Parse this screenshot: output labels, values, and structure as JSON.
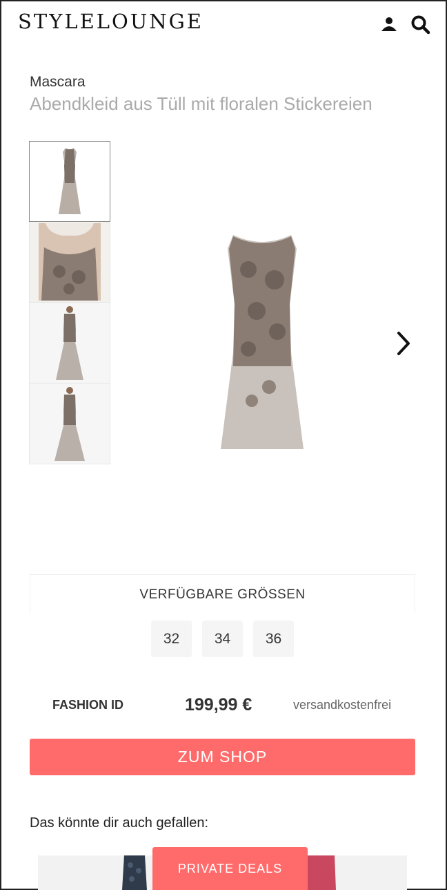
{
  "header": {
    "logo": "STYLELOUNGE",
    "user_icon": "user-icon",
    "search_icon": "search-icon"
  },
  "product": {
    "brand": "Mascara",
    "title": "Abendkleid aus Tüll mit floralen Stickereien"
  },
  "gallery": {
    "thumbnails": [
      "dress-front",
      "dress-closeup",
      "model-front",
      "model-front-2"
    ],
    "next_icon": "chevron-right-icon"
  },
  "sizes": {
    "label": "VERFÜGBARE GRÖSSEN",
    "options": [
      "32",
      "34",
      "36"
    ]
  },
  "offer": {
    "shop": "FASHION ID",
    "price": "199,99 €",
    "shipping": "versandkostenfrei",
    "button": "ZUM SHOP"
  },
  "recommendations": {
    "heading": "Das könnte dir auch gefallen:"
  },
  "deals": {
    "label": "PRIVATE DEALS"
  },
  "colors": {
    "accent": "#ff6b6b",
    "title_gray": "#aaaaaa",
    "chip_bg": "#f5f5f5"
  }
}
